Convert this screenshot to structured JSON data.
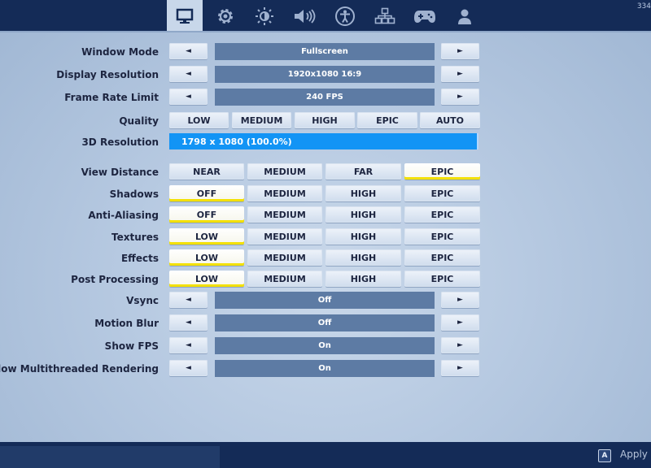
{
  "tabs": [
    {
      "icon": "monitor-icon",
      "active": true
    },
    {
      "icon": "gear-icon",
      "active": false
    },
    {
      "icon": "brightness-icon",
      "active": false
    },
    {
      "icon": "speaker-icon",
      "active": false
    },
    {
      "icon": "accessibility-icon",
      "active": false
    },
    {
      "icon": "network-icon",
      "active": false
    },
    {
      "icon": "gamepad-icon",
      "active": false
    },
    {
      "icon": "account-icon",
      "active": false
    }
  ],
  "top_counter": "334",
  "arrows": {
    "left": "◄",
    "right": "►"
  },
  "settings": {
    "window_mode": {
      "label": "Window Mode",
      "value": "Fullscreen"
    },
    "display_resolution": {
      "label": "Display Resolution",
      "value": "1920x1080 16:9"
    },
    "frame_rate_limit": {
      "label": "Frame Rate Limit",
      "value": "240 FPS"
    },
    "quality": {
      "label": "Quality",
      "options": [
        "LOW",
        "MEDIUM",
        "HIGH",
        "EPIC",
        "AUTO"
      ]
    },
    "resolution_3d": {
      "label": "3D Resolution",
      "value": "1798 x 1080 (100.0%)"
    },
    "view_distance": {
      "label": "View Distance",
      "options": [
        "NEAR",
        "MEDIUM",
        "FAR",
        "EPIC"
      ],
      "selected": "EPIC"
    },
    "shadows": {
      "label": "Shadows",
      "options": [
        "OFF",
        "MEDIUM",
        "HIGH",
        "EPIC"
      ],
      "selected": "OFF"
    },
    "anti_aliasing": {
      "label": "Anti-Aliasing",
      "options": [
        "OFF",
        "MEDIUM",
        "HIGH",
        "EPIC"
      ],
      "selected": "OFF"
    },
    "textures": {
      "label": "Textures",
      "options": [
        "LOW",
        "MEDIUM",
        "HIGH",
        "EPIC"
      ],
      "selected": "LOW"
    },
    "effects": {
      "label": "Effects",
      "options": [
        "LOW",
        "MEDIUM",
        "HIGH",
        "EPIC"
      ],
      "selected": "LOW"
    },
    "post_processing": {
      "label": "Post Processing",
      "options": [
        "LOW",
        "MEDIUM",
        "HIGH",
        "EPIC"
      ],
      "selected": "LOW"
    },
    "vsync": {
      "label": "Vsync",
      "value": "Off"
    },
    "motion_blur": {
      "label": "Motion Blur",
      "value": "Off"
    },
    "show_fps": {
      "label": "Show FPS",
      "value": "On"
    },
    "multithreaded": {
      "label": "Allow Multithreaded Rendering",
      "value": "On"
    }
  },
  "footer": {
    "apply_key": "A",
    "apply_label": "Apply"
  },
  "colors": {
    "accent_blue": "#1294f5",
    "selected_underline": "#f3e000",
    "bar": "#142b57"
  }
}
